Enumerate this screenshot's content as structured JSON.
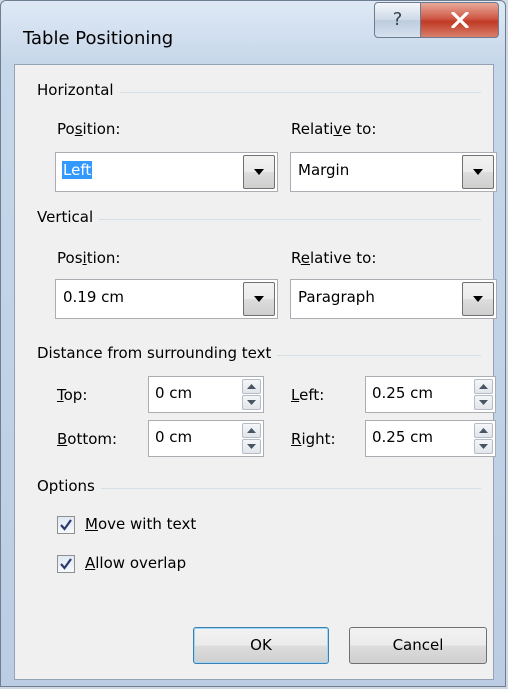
{
  "window": {
    "title": "Table Positioning",
    "help_glyph": "?"
  },
  "horizontal": {
    "section_label": "Horizontal",
    "position_label": {
      "pre": "Po",
      "key": "s",
      "post": "ition:"
    },
    "position_value": "Left",
    "relative_label": {
      "pre": "Relati",
      "key": "v",
      "post": "e to:"
    },
    "relative_value": "Margin"
  },
  "vertical": {
    "section_label": "Vertical",
    "position_label": {
      "pre": "Pos",
      "key": "i",
      "post": "tion:"
    },
    "position_value": "0.19 cm",
    "relative_label": {
      "pre": "R",
      "key": "e",
      "post": "lative to:"
    },
    "relative_value": "Paragraph"
  },
  "distance": {
    "section_label": "Distance from surrounding text",
    "top_label": {
      "key": "T",
      "post": "op:"
    },
    "top_value": "0 cm",
    "bottom_label": {
      "key": "B",
      "post": "ottom:"
    },
    "bottom_value": "0 cm",
    "left_label": {
      "key": "L",
      "post": "eft:"
    },
    "left_value": "0.25 cm",
    "right_label": {
      "key": "R",
      "post": "ight:"
    },
    "right_value": "0.25 cm"
  },
  "options": {
    "section_label": "Options",
    "move_with_text": {
      "key": "M",
      "post": "ove with text",
      "checked": true
    },
    "allow_overlap": {
      "key": "A",
      "post": "llow overlap",
      "checked": true
    }
  },
  "buttons": {
    "ok": "OK",
    "cancel": "Cancel"
  },
  "colors": {
    "selection": "#3399ff",
    "close_button": "#c03a25",
    "default_button_border": "#3c7fb1"
  }
}
